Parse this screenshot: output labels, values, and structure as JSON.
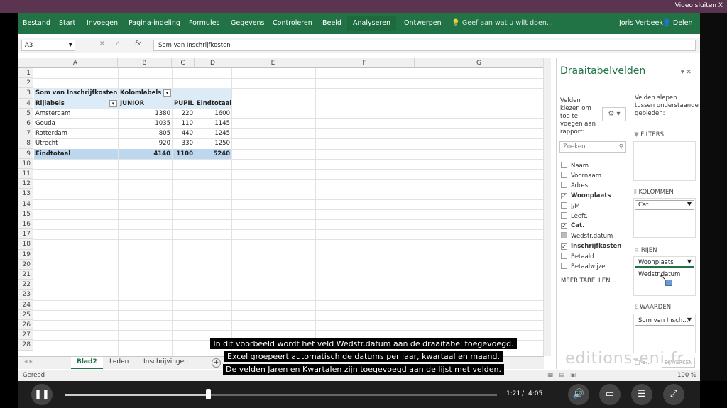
{
  "video_close": "Video sluiten  X",
  "ribbon": {
    "tabs": [
      "Bestand",
      "Start",
      "Invoegen",
      "Pagina-indeling",
      "Formules",
      "Gegevens",
      "Controleren",
      "Beeld",
      "Analyseren",
      "Ontwerpen"
    ],
    "active": "Analyseren",
    "tell_me": "Geef aan wat u wilt doen...",
    "user": "Joris Verbeek",
    "share": "Delen"
  },
  "formula_bar": {
    "name_box": "A3",
    "fx": "fx",
    "value": "Som van Inschrijfkosten"
  },
  "columns": [
    "A",
    "B",
    "C",
    "D",
    "E",
    "F",
    "G"
  ],
  "rows": [
    "1",
    "2",
    "3",
    "4",
    "5",
    "6",
    "7",
    "8",
    "9",
    "10",
    "11",
    "12",
    "13",
    "14",
    "15",
    "16",
    "17",
    "18",
    "19",
    "20",
    "21",
    "22",
    "23",
    "24",
    "25",
    "26",
    "27",
    "28"
  ],
  "pivot": {
    "corner": "Som van Inschrijfkosten",
    "col_labels": "Kolomlabels",
    "row_labels": "Rijlabels",
    "headers": [
      "JUNIOR",
      "PUPIL",
      "Eindtotaal"
    ],
    "data": [
      [
        "Amsterdam",
        "1380",
        "220",
        "1600"
      ],
      [
        "Gouda",
        "1035",
        "110",
        "1145"
      ],
      [
        "Rotterdam",
        "805",
        "440",
        "1245"
      ],
      [
        "Utrecht",
        "920",
        "330",
        "1250"
      ]
    ],
    "total": [
      "Eindtotaal",
      "4140",
      "1100",
      "5240"
    ]
  },
  "sheet_tabs": [
    "Blad2",
    "Leden",
    "Inschrijvingen"
  ],
  "active_sheet": "Blad2",
  "status": {
    "ready": "Gereed",
    "zoom": "100 %"
  },
  "pane": {
    "title": "Draaitabelvelden",
    "choose_text": "Velden kiezen om toe te voegen aan rapport:",
    "drag_text": "Velden slepen tussen onderstaande gebieden:",
    "search_placeholder": "Zoeken",
    "fields": [
      {
        "name": "Naam",
        "state": "off"
      },
      {
        "name": "Voornaam",
        "state": "off"
      },
      {
        "name": "Adres",
        "state": "off"
      },
      {
        "name": "Woonplaats",
        "state": "on"
      },
      {
        "name": "J/M",
        "state": "off"
      },
      {
        "name": "Leeft.",
        "state": "off"
      },
      {
        "name": "Cat.",
        "state": "on"
      },
      {
        "name": "Wedstr.datum",
        "state": "grey"
      },
      {
        "name": "Inschrijfkosten",
        "state": "on"
      },
      {
        "name": "Betaald",
        "state": "off"
      },
      {
        "name": "Betaalwijze",
        "state": "off"
      }
    ],
    "more_tables": "MEER TABELLEN...",
    "zones": {
      "filters": "FILTERS",
      "columns": "KOLOMMEN",
      "rows": "RIJEN",
      "values": "WAARDEN"
    },
    "col_item": "Cat.",
    "row_item": "Woonplaats",
    "row_dragging": "Wedstr.datum",
    "value_item": "Som van Insch...",
    "defer": "B...",
    "update": "BIJWERKEN"
  },
  "subtitles": [
    "In dit voorbeeld wordt het veld Wedstr.datum aan de draaitabel toegevoegd.",
    "Excel groepeert automatisch de datums per jaar, kwartaal en maand.",
    "De velden Jaren en Kwartalen zijn toegevoegd aan de lijst met velden."
  ],
  "player": {
    "current": "1:21",
    "separator": "/",
    "total": "4:05",
    "progress_fraction": 0.33
  },
  "watermark": "editions-eni.fr"
}
